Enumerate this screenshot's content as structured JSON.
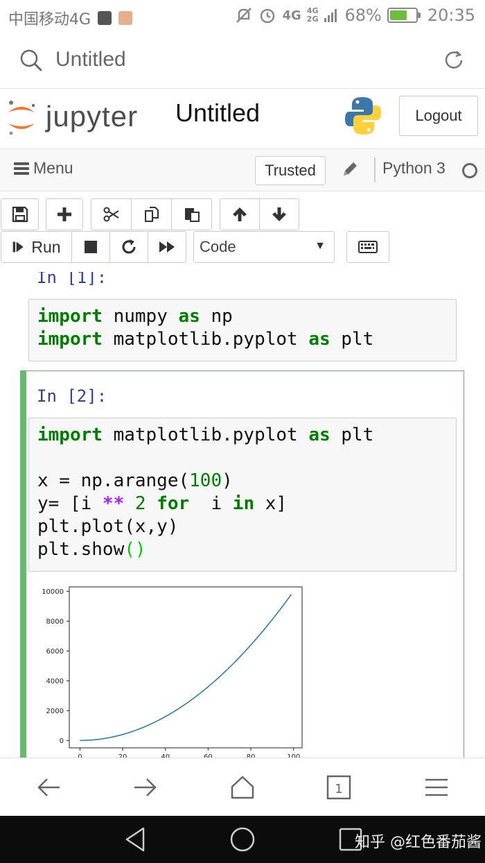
{
  "status_bar": {
    "carrier": "中国移动4G",
    "network": "4G",
    "signal_labels": [
      "4G",
      "2G"
    ],
    "battery_percent": "68%",
    "battery_level": 0.68,
    "time": "20:35"
  },
  "browser": {
    "url_title": "Untitled"
  },
  "jupyter": {
    "logo_text": "jupyter",
    "notebook_name": "Untitled",
    "logout_label": "Logout"
  },
  "menubar": {
    "menu_label": "Menu",
    "trusted_label": "Trusted",
    "kernel_name": "Python 3"
  },
  "toolbar": {
    "run_label": "Run",
    "cell_type": "Code"
  },
  "cells": [
    {
      "prompt": "In [1]:"
    },
    {
      "prompt": "In [2]:"
    }
  ],
  "chart_data": {
    "type": "line",
    "x_range": [
      0,
      99
    ],
    "function": "y = x ** 2",
    "xlim": [
      -5,
      104
    ],
    "ylim": [
      -495,
      10296
    ],
    "x_ticks": [
      0,
      20,
      40,
      60,
      80,
      100
    ],
    "y_ticks": [
      0,
      2000,
      4000,
      6000,
      8000,
      10000
    ],
    "line_color": "#1f77b4"
  },
  "watermark": "知乎 @红色番茄酱",
  "colors": {
    "selected_cell": "#66bb6a",
    "prompt": "#303f9f",
    "keyword": "#008000",
    "operator": "#aa22ff"
  }
}
